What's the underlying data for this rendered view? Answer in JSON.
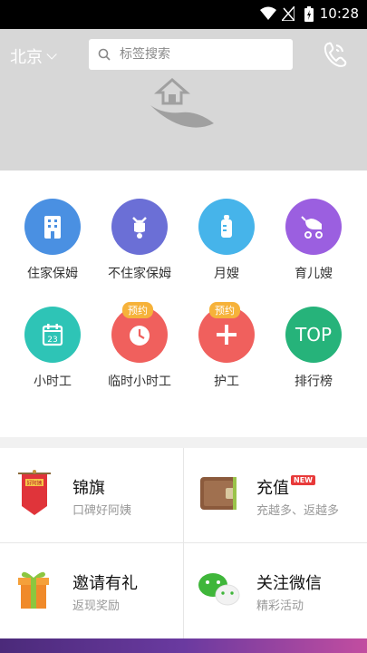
{
  "status_bar": {
    "time": "10:28"
  },
  "header": {
    "city": "北京",
    "search_placeholder": "标签搜索"
  },
  "services": [
    {
      "label": "住家保姆",
      "color": "#4a90e2",
      "icon": "building-icon"
    },
    {
      "label": "不住家保姆",
      "color": "#6b6fd6",
      "icon": "scooter-icon"
    },
    {
      "label": "月嫂",
      "color": "#46b4ea",
      "icon": "bottle-icon"
    },
    {
      "label": "育儿嫂",
      "color": "#9b5fe0",
      "icon": "stroller-icon"
    },
    {
      "label": "小时工",
      "color": "#2ec4b6",
      "icon": "calendar-icon",
      "calendar_day": "23"
    },
    {
      "label": "临时小时工",
      "color": "#f0605d",
      "icon": "clock-icon",
      "badge": "预约"
    },
    {
      "label": "护工",
      "color": "#f0605d",
      "icon": "plus-icon",
      "badge": "预约"
    },
    {
      "label": "排行榜",
      "color": "#26b37a",
      "icon": "top-icon",
      "icon_text": "TOP"
    }
  ],
  "tiles": [
    {
      "title": "锦旗",
      "subtitle": "口碑好阿姨",
      "icon": "banner-flag-icon",
      "flag_text": "好阿姨"
    },
    {
      "title": "充值",
      "subtitle": "充越多、返越多",
      "icon": "wallet-icon",
      "badge": "NEW"
    },
    {
      "title": "邀请有礼",
      "subtitle": "返现奖励",
      "icon": "gift-icon"
    },
    {
      "title": "关注微信",
      "subtitle": "精彩活动",
      "icon": "wechat-icon"
    }
  ]
}
